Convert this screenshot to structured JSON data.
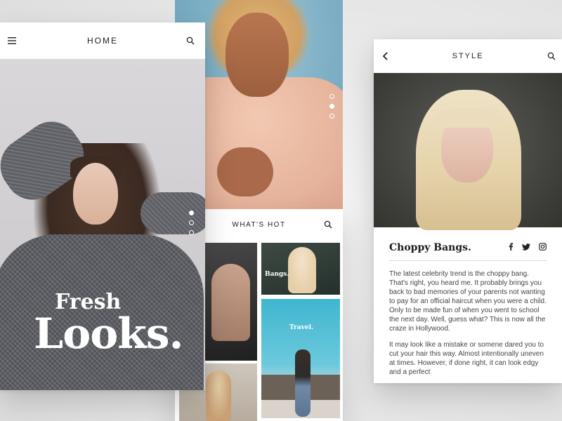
{
  "home": {
    "title": "HOME",
    "headline_small": "Fresh",
    "headline_large": "Looks."
  },
  "whats_hot": {
    "title": "WHAT'S HOT",
    "tiles": [
      {
        "label": ""
      },
      {
        "label": "Bangs."
      },
      {
        "label": "Travel."
      },
      {
        "label": ""
      }
    ]
  },
  "style": {
    "title": "STYLE",
    "article_title": "Choppy Bangs.",
    "paragraph_1": "The latest celebrity trend is the choppy bang.  That's right, you heard me.  It probably brings you back to bad memories of your parents not wanting to pay for an official haircut when you were a child.  Only to be made fun of when you went to school the next day.  Well, guess what?  This is now all the craze in Hollywood.",
    "paragraph_2": "It may look like a mistake or somene dared you to cut your hair this way.  Almost intentionally uneven at times.  However, if done right, it can look edgy and a perfect"
  },
  "carousel": {
    "home_active_index": 0,
    "mid_active_index": 1
  },
  "icons": {
    "menu": "menu-icon",
    "search": "search-icon",
    "back": "chevron-left-icon",
    "facebook": "facebook-icon",
    "twitter": "twitter-icon",
    "instagram": "instagram-icon"
  },
  "colors": {
    "background": "#ececec",
    "text_dark": "#222222",
    "body_text": "#444444"
  }
}
